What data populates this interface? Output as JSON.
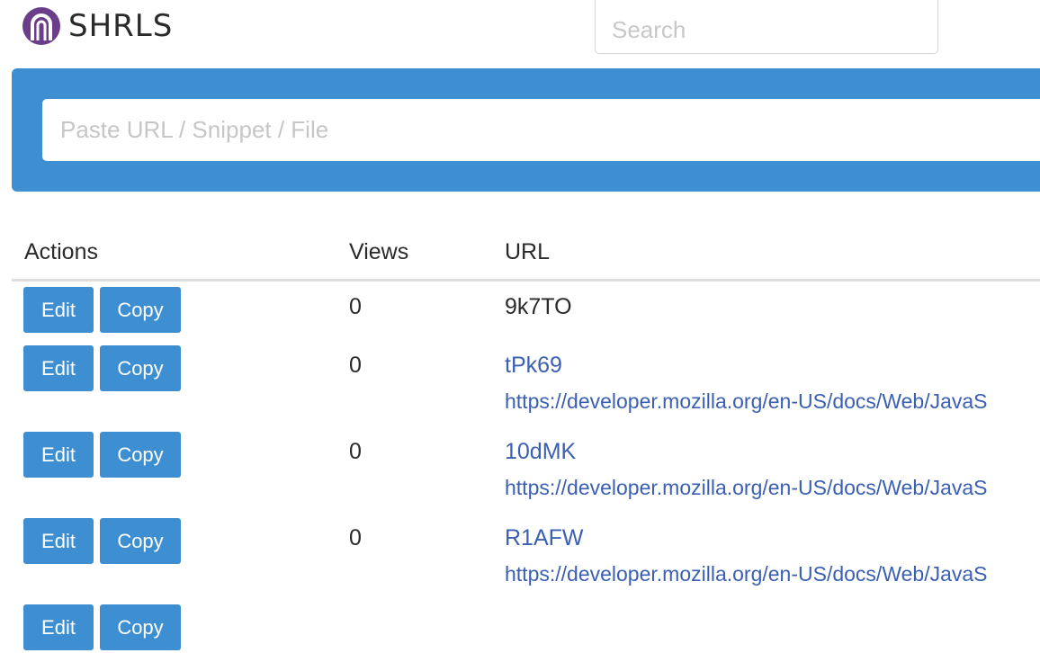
{
  "header": {
    "app_name": "SHRLS",
    "search_placeholder": "Search"
  },
  "banner": {
    "input_placeholder": "Paste URL / Snippet / File"
  },
  "table": {
    "columns": {
      "actions": "Actions",
      "views": "Views",
      "url": "URL"
    },
    "rows": [
      {
        "edit_label": "Edit",
        "copy_label": "Copy",
        "views": "0",
        "code": "9k7TO",
        "target": ""
      },
      {
        "edit_label": "Edit",
        "copy_label": "Copy",
        "views": "0",
        "code": "tPk69",
        "target": "https://developer.mozilla.org/en-US/docs/Web/JavaS"
      },
      {
        "edit_label": "Edit",
        "copy_label": "Copy",
        "views": "0",
        "code": "10dMK",
        "target": "https://developer.mozilla.org/en-US/docs/Web/JavaS"
      },
      {
        "edit_label": "Edit",
        "copy_label": "Copy",
        "views": "0",
        "code": "R1AFW",
        "target": "https://developer.mozilla.org/en-US/docs/Web/JavaS"
      },
      {
        "edit_label": "Edit",
        "copy_label": "Copy",
        "views": "",
        "code": "",
        "target": ""
      }
    ]
  },
  "colors": {
    "accent": "#3d8fd1",
    "link": "#3a5fb3",
    "logo": "#6a3e8a"
  },
  "icons": {
    "logo": "shrls-logo-icon"
  }
}
